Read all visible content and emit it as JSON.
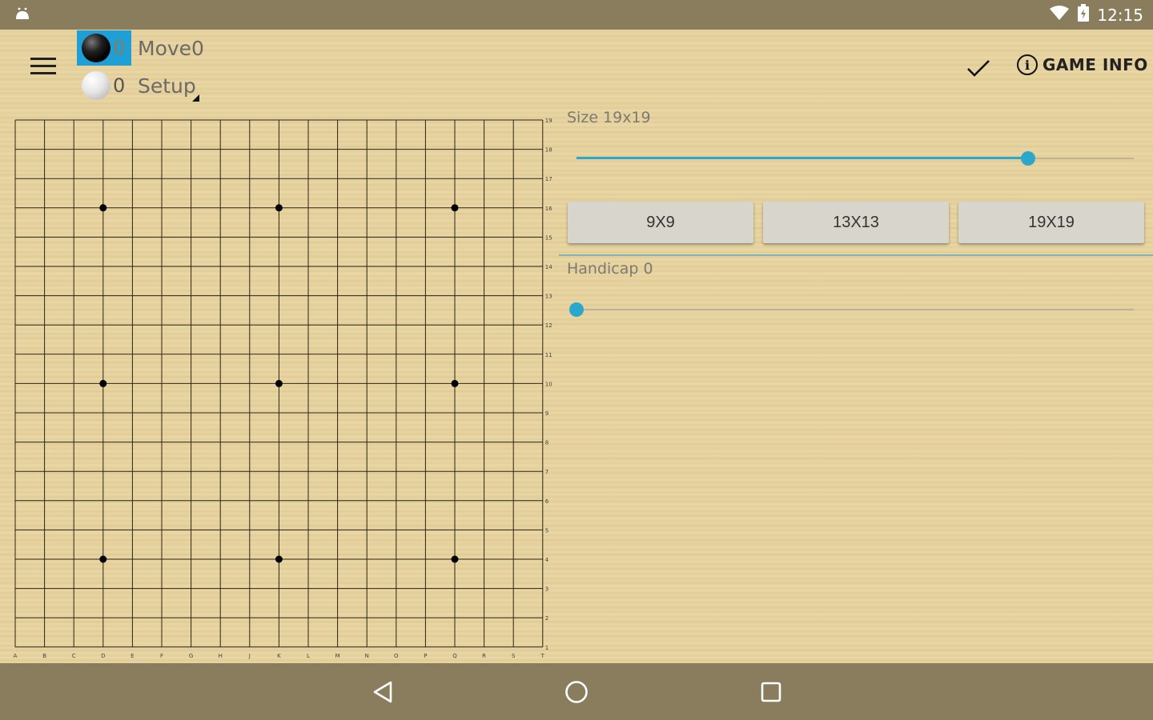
{
  "status_bar": {
    "time": "12:15",
    "left_icon": "android-debug-icon",
    "right_icons": [
      "wifi-icon",
      "battery-icon"
    ]
  },
  "toolbar": {
    "menu_icon": "hamburger-menu-icon",
    "players": [
      {
        "stone": "black",
        "count": "0",
        "label": "Move0",
        "active": true
      },
      {
        "stone": "white",
        "count": "0",
        "label": "Setup",
        "active": false
      }
    ],
    "confirm_icon": "checkmark-icon",
    "game_info_label": "GAME INFO",
    "game_info_icon": "info-icon"
  },
  "board": {
    "size": 19,
    "col_labels": [
      "A",
      "B",
      "C",
      "D",
      "E",
      "F",
      "G",
      "H",
      "J",
      "K",
      "L",
      "M",
      "N",
      "O",
      "P",
      "Q",
      "R",
      "S",
      "T"
    ],
    "row_labels": [
      "19",
      "18",
      "17",
      "16",
      "15",
      "14",
      "13",
      "12",
      "11",
      "10",
      "9",
      "8",
      "7",
      "6",
      "5",
      "4",
      "3",
      "2",
      "1"
    ],
    "star_points": [
      [
        3,
        3
      ],
      [
        9,
        3
      ],
      [
        15,
        3
      ],
      [
        3,
        9
      ],
      [
        9,
        9
      ],
      [
        15,
        9
      ],
      [
        3,
        15
      ],
      [
        9,
        15
      ],
      [
        15,
        15
      ]
    ]
  },
  "settings": {
    "size_label": "Size 19x19",
    "size_slider_value": 0.81,
    "size_buttons": [
      "9X9",
      "13X13",
      "19X19"
    ],
    "handicap_label": "Handicap 0",
    "handicap_slider_value": 0
  },
  "nav_bar": {
    "icons": [
      "back-icon",
      "home-icon",
      "recent-apps-icon"
    ]
  },
  "colors": {
    "accent": "#2ba7cc",
    "bar": "#8a7d5d",
    "wood": "#e8d49f"
  }
}
